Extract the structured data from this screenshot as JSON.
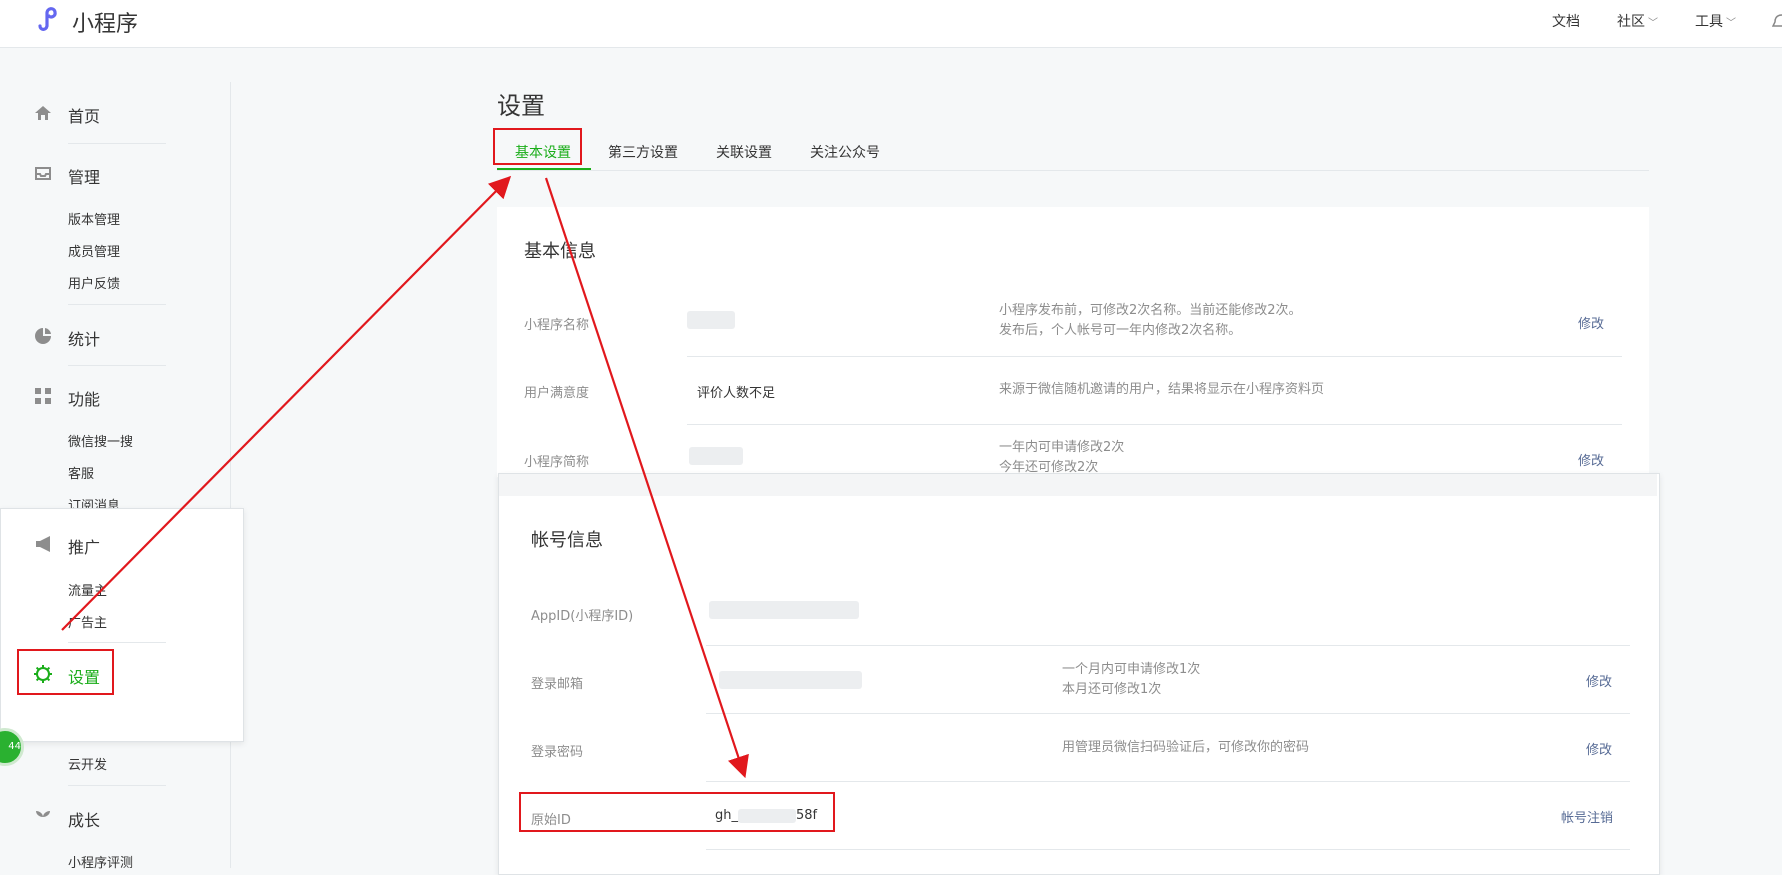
{
  "header": {
    "brand": "小程序",
    "nav": [
      {
        "label": "文档"
      },
      {
        "label": "社区"
      },
      {
        "label": "工具"
      }
    ]
  },
  "sidebar": {
    "home": "首页",
    "manage": "管理",
    "manage_items": [
      "版本管理",
      "成员管理",
      "用户反馈"
    ],
    "stats": "统计",
    "features": "功能",
    "feature_items": [
      "微信搜一搜",
      "客服",
      "订阅消息"
    ],
    "promote": "推广",
    "promote_items": [
      "流量主",
      "广告主"
    ],
    "settings": "设置",
    "cloud": "云开发",
    "growth": "成长",
    "growth_items": [
      "小程序评测"
    ],
    "badge": "44"
  },
  "main": {
    "title": "设置",
    "tabs": [
      "基本设置",
      "第三方设置",
      "关联设置",
      "关注公众号"
    ],
    "basic_info": {
      "title": "基本信息",
      "rows": [
        {
          "label": "小程序名称",
          "desc1": "小程序发布前，可修改2次名称。当前还能修改2次。",
          "desc2": "发布后，个人帐号可一年内修改2次名称。",
          "action": "修改"
        },
        {
          "label": "用户满意度",
          "value": "评价人数不足",
          "desc1": "来源于微信随机邀请的用户，结果将显示在小程序资料页"
        },
        {
          "label": "小程序简称",
          "desc1": "一年内可申请修改2次",
          "desc2": "今年还可修改2次",
          "action": "修改"
        }
      ]
    },
    "account_info": {
      "title": "帐号信息",
      "rows": [
        {
          "label": "AppID(小程序ID)"
        },
        {
          "label": "登录邮箱",
          "desc1": "一个月内可申请修改1次",
          "desc2": "本月还可修改1次",
          "action": "修改"
        },
        {
          "label": "登录密码",
          "desc1": "用管理员微信扫码验证后，可修改你的密码",
          "action": "修改"
        },
        {
          "label": "原始ID",
          "value_prefix": "gh_",
          "value_suffix": "58f",
          "action": "帐号注销"
        }
      ]
    }
  },
  "colors": {
    "accent_green": "#1aad19",
    "link_blue": "#576b95",
    "annotation_red": "#e1181d"
  }
}
